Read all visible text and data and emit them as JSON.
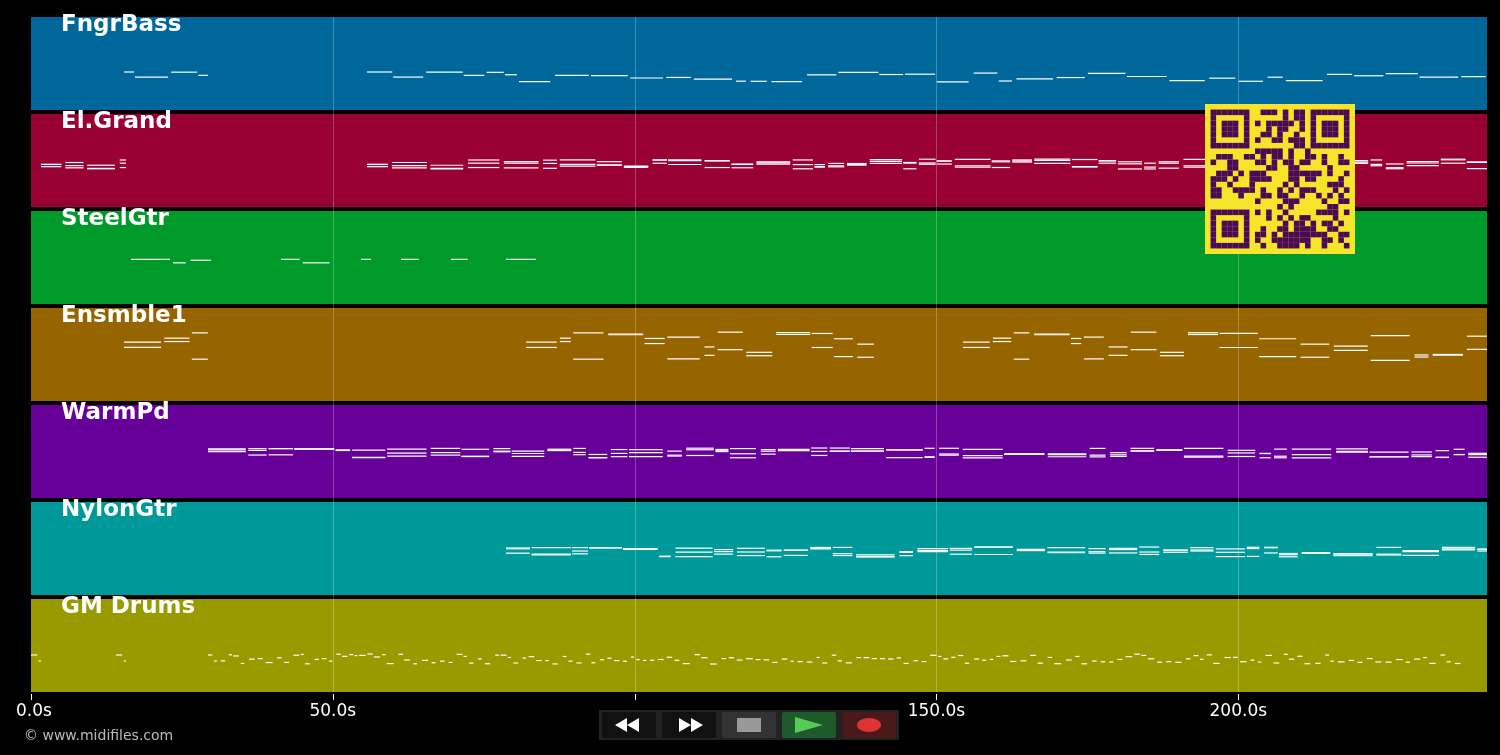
{
  "tracks": [
    {
      "name": "FngrBass",
      "color": "#00679a"
    },
    {
      "name": "El.Grand",
      "color": "#990033"
    },
    {
      "name": "SteelGtr",
      "color": "#009a2a"
    },
    {
      "name": "Ensmble1",
      "color": "#966500"
    },
    {
      "name": "WarmPd",
      "color": "#660099"
    },
    {
      "name": "NylonGtr",
      "color": "#009999"
    },
    {
      "name": "GM Drums",
      "color": "#999900"
    }
  ],
  "time_axis": [
    {
      "label": "0.0s"
    },
    {
      "label": "50.0s"
    },
    {
      "label": "150.0s"
    },
    {
      "label": "200.0s"
    }
  ],
  "transport": [
    {
      "kind": "rewind"
    },
    {
      "kind": "forward"
    },
    {
      "kind": "stop"
    },
    {
      "kind": "play"
    },
    {
      "kind": "record"
    }
  ],
  "credit": "© www.midifiles.com"
}
